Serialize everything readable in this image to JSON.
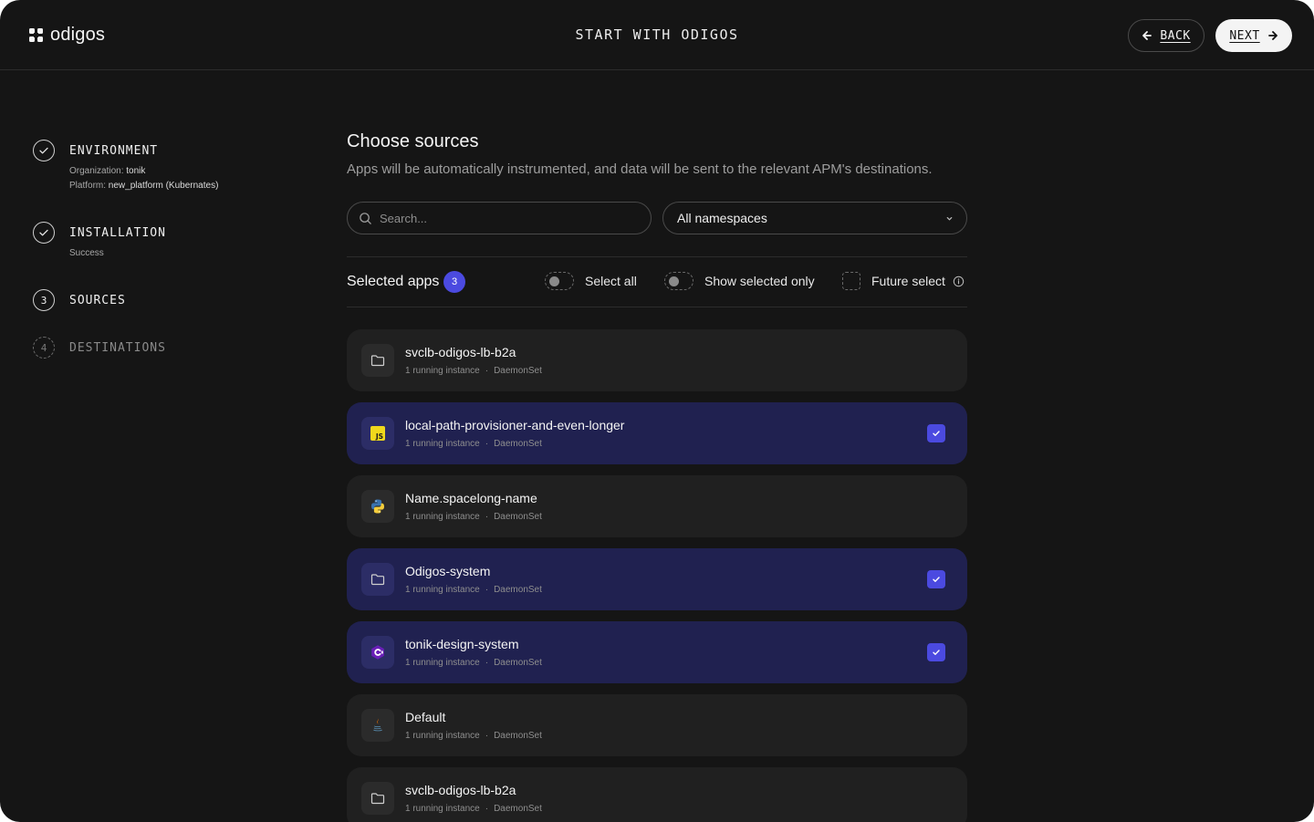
{
  "header": {
    "logo_text": "odigos",
    "title": "START WITH ODIGOS",
    "back_label": "BACK",
    "next_label": "NEXT"
  },
  "stepper": {
    "steps": [
      {
        "number": "1",
        "title": "ENVIRONMENT",
        "state": "done",
        "details": [
          {
            "label": "Organization:",
            "value": "tonik"
          },
          {
            "label": "Platform:",
            "value": "new_platform (Kubernates)"
          }
        ]
      },
      {
        "number": "2",
        "title": "INSTALLATION",
        "state": "done",
        "subtitle": "Success"
      },
      {
        "number": "3",
        "title": "SOURCES",
        "state": "active"
      },
      {
        "number": "4",
        "title": "DESTINATIONS",
        "state": "pending"
      }
    ]
  },
  "main": {
    "title": "Choose sources",
    "subtitle": "Apps will be automatically instrumented, and data will be sent to the relevant APM's destinations.",
    "search_placeholder": "Search...",
    "namespace_select": "All namespaces",
    "selected_label": "Selected apps",
    "selected_count": "3",
    "select_all_label": "Select all",
    "show_selected_only_label": "Show selected only",
    "future_select_label": "Future select"
  },
  "sources": [
    {
      "name": "svclb-odigos-lb-b2a",
      "instances": "1 running instance",
      "kind": "DaemonSet",
      "icon": "folder-icon",
      "selected": false
    },
    {
      "name": "local-path-provisioner-and-even-longer",
      "instances": "1 running instance",
      "kind": "DaemonSet",
      "icon": "javascript-icon",
      "selected": true
    },
    {
      "name": "Name.spacelong-name",
      "instances": "1 running instance",
      "kind": "DaemonSet",
      "icon": "python-icon",
      "selected": false
    },
    {
      "name": "Odigos-system",
      "instances": "1 running instance",
      "kind": "DaemonSet",
      "icon": "folder-icon",
      "selected": true
    },
    {
      "name": "tonik-design-system",
      "instances": "1 running instance",
      "kind": "DaemonSet",
      "icon": "csharp-icon",
      "selected": true
    },
    {
      "name": "Default",
      "instances": "1 running instance",
      "kind": "DaemonSet",
      "icon": "java-icon",
      "selected": false
    },
    {
      "name": "svclb-odigos-lb-b2a",
      "instances": "1 running instance",
      "kind": "DaemonSet",
      "icon": "folder-icon",
      "selected": false
    }
  ],
  "colors": {
    "background": "#151515",
    "card": "#202020",
    "card_selected": "#202150",
    "accent": "#4b4ae0"
  }
}
